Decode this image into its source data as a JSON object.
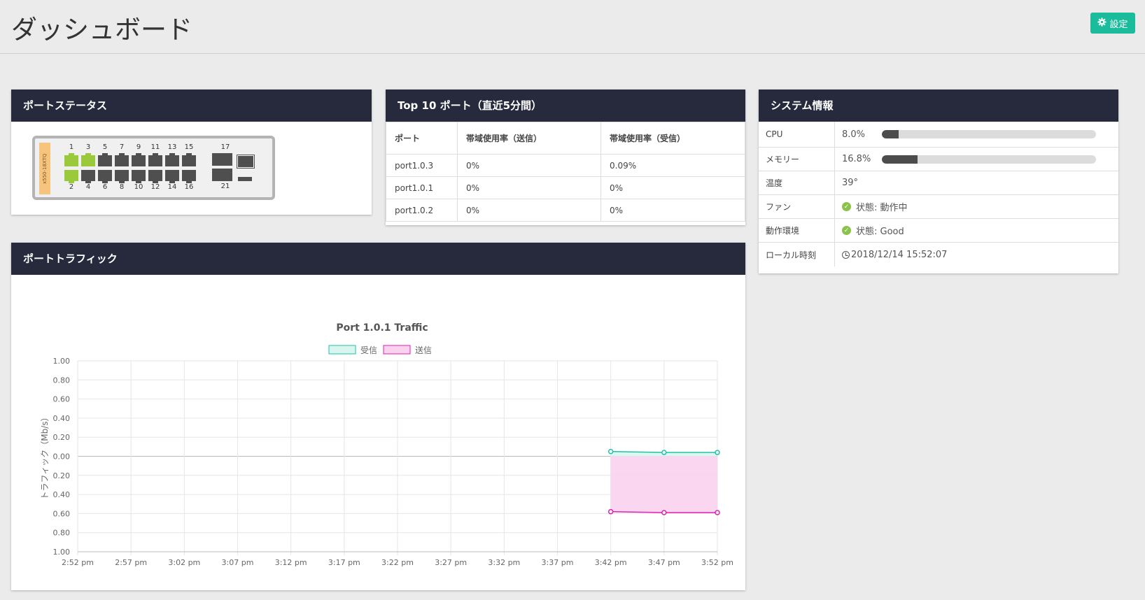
{
  "header": {
    "title": "ダッシュボード",
    "settings_label": "設定"
  },
  "port_status": {
    "title": "ポートステータス",
    "model_label": "x550-18XTQ",
    "top_numbers": [
      "1",
      "3",
      "5",
      "7",
      "9",
      "11",
      "13",
      "15"
    ],
    "bottom_numbers": [
      "2",
      "4",
      "6",
      "8",
      "10",
      "12",
      "14",
      "16"
    ],
    "sfp_top": "17",
    "sfp_bottom": "21",
    "up_ports": [
      "1",
      "2",
      "3"
    ]
  },
  "top10": {
    "title": "Top 10 ポート（直近5分間）",
    "columns": [
      "ポート",
      "帯域使用率（送信）",
      "帯域使用率（受信）"
    ],
    "rows": [
      [
        "port1.0.3",
        "0%",
        "0.09%"
      ],
      [
        "port1.0.1",
        "0%",
        "0%"
      ],
      [
        "port1.0.2",
        "0%",
        "0%"
      ]
    ]
  },
  "system": {
    "title": "システム情報",
    "cpu_label": "CPU",
    "cpu_value": "8.0%",
    "cpu_fraction": 0.08,
    "mem_label": "メモリー",
    "mem_value": "16.8%",
    "mem_fraction": 0.168,
    "temp_label": "温度",
    "temp_value": "39°",
    "fan_label": "ファン",
    "fan_value": "状態: 動作中",
    "env_label": "動作環境",
    "env_value": "状態: Good",
    "time_label": "ローカル時刻",
    "time_value": "2018/12/14 15:52:07"
  },
  "traffic": {
    "title": "ポートトラフィック"
  },
  "colors": {
    "accent": "#1abc9c",
    "header_bg": "#262a3c",
    "port_up": "#9ac93b",
    "rx": "#1fc4a7",
    "tx": "#e020b0"
  },
  "chart_data": {
    "type": "line",
    "title": "Port 1.0.1 Traffic",
    "xlabel": "",
    "ylabel": "トラフィック（Mb/s）",
    "categories": [
      "2:52 pm",
      "2:57 pm",
      "3:02 pm",
      "3:07 pm",
      "3:12 pm",
      "3:17 pm",
      "3:22 pm",
      "3:27 pm",
      "3:32 pm",
      "3:37 pm",
      "3:42 pm",
      "3:47 pm",
      "3:52 pm"
    ],
    "y_tick_labels": [
      "1.00",
      "0.80",
      "0.60",
      "0.40",
      "0.20",
      "0.00",
      "0.20",
      "0.40",
      "0.60",
      "0.80",
      "1.00"
    ],
    "ylim": [
      -1,
      1
    ],
    "grid": true,
    "legend": "top",
    "series": [
      {
        "name": "受信",
        "x": [
          "3:42 pm",
          "3:47 pm",
          "3:52 pm"
        ],
        "values": [
          0.05,
          0.04,
          0.04
        ],
        "color": "#1fc4a7",
        "fill": "#d9f5ef"
      },
      {
        "name": "送信",
        "x": [
          "3:42 pm",
          "3:47 pm",
          "3:52 pm"
        ],
        "values": [
          -0.58,
          -0.59,
          -0.59
        ],
        "color": "#e020b0",
        "fill": "#f9d2ee"
      }
    ]
  }
}
